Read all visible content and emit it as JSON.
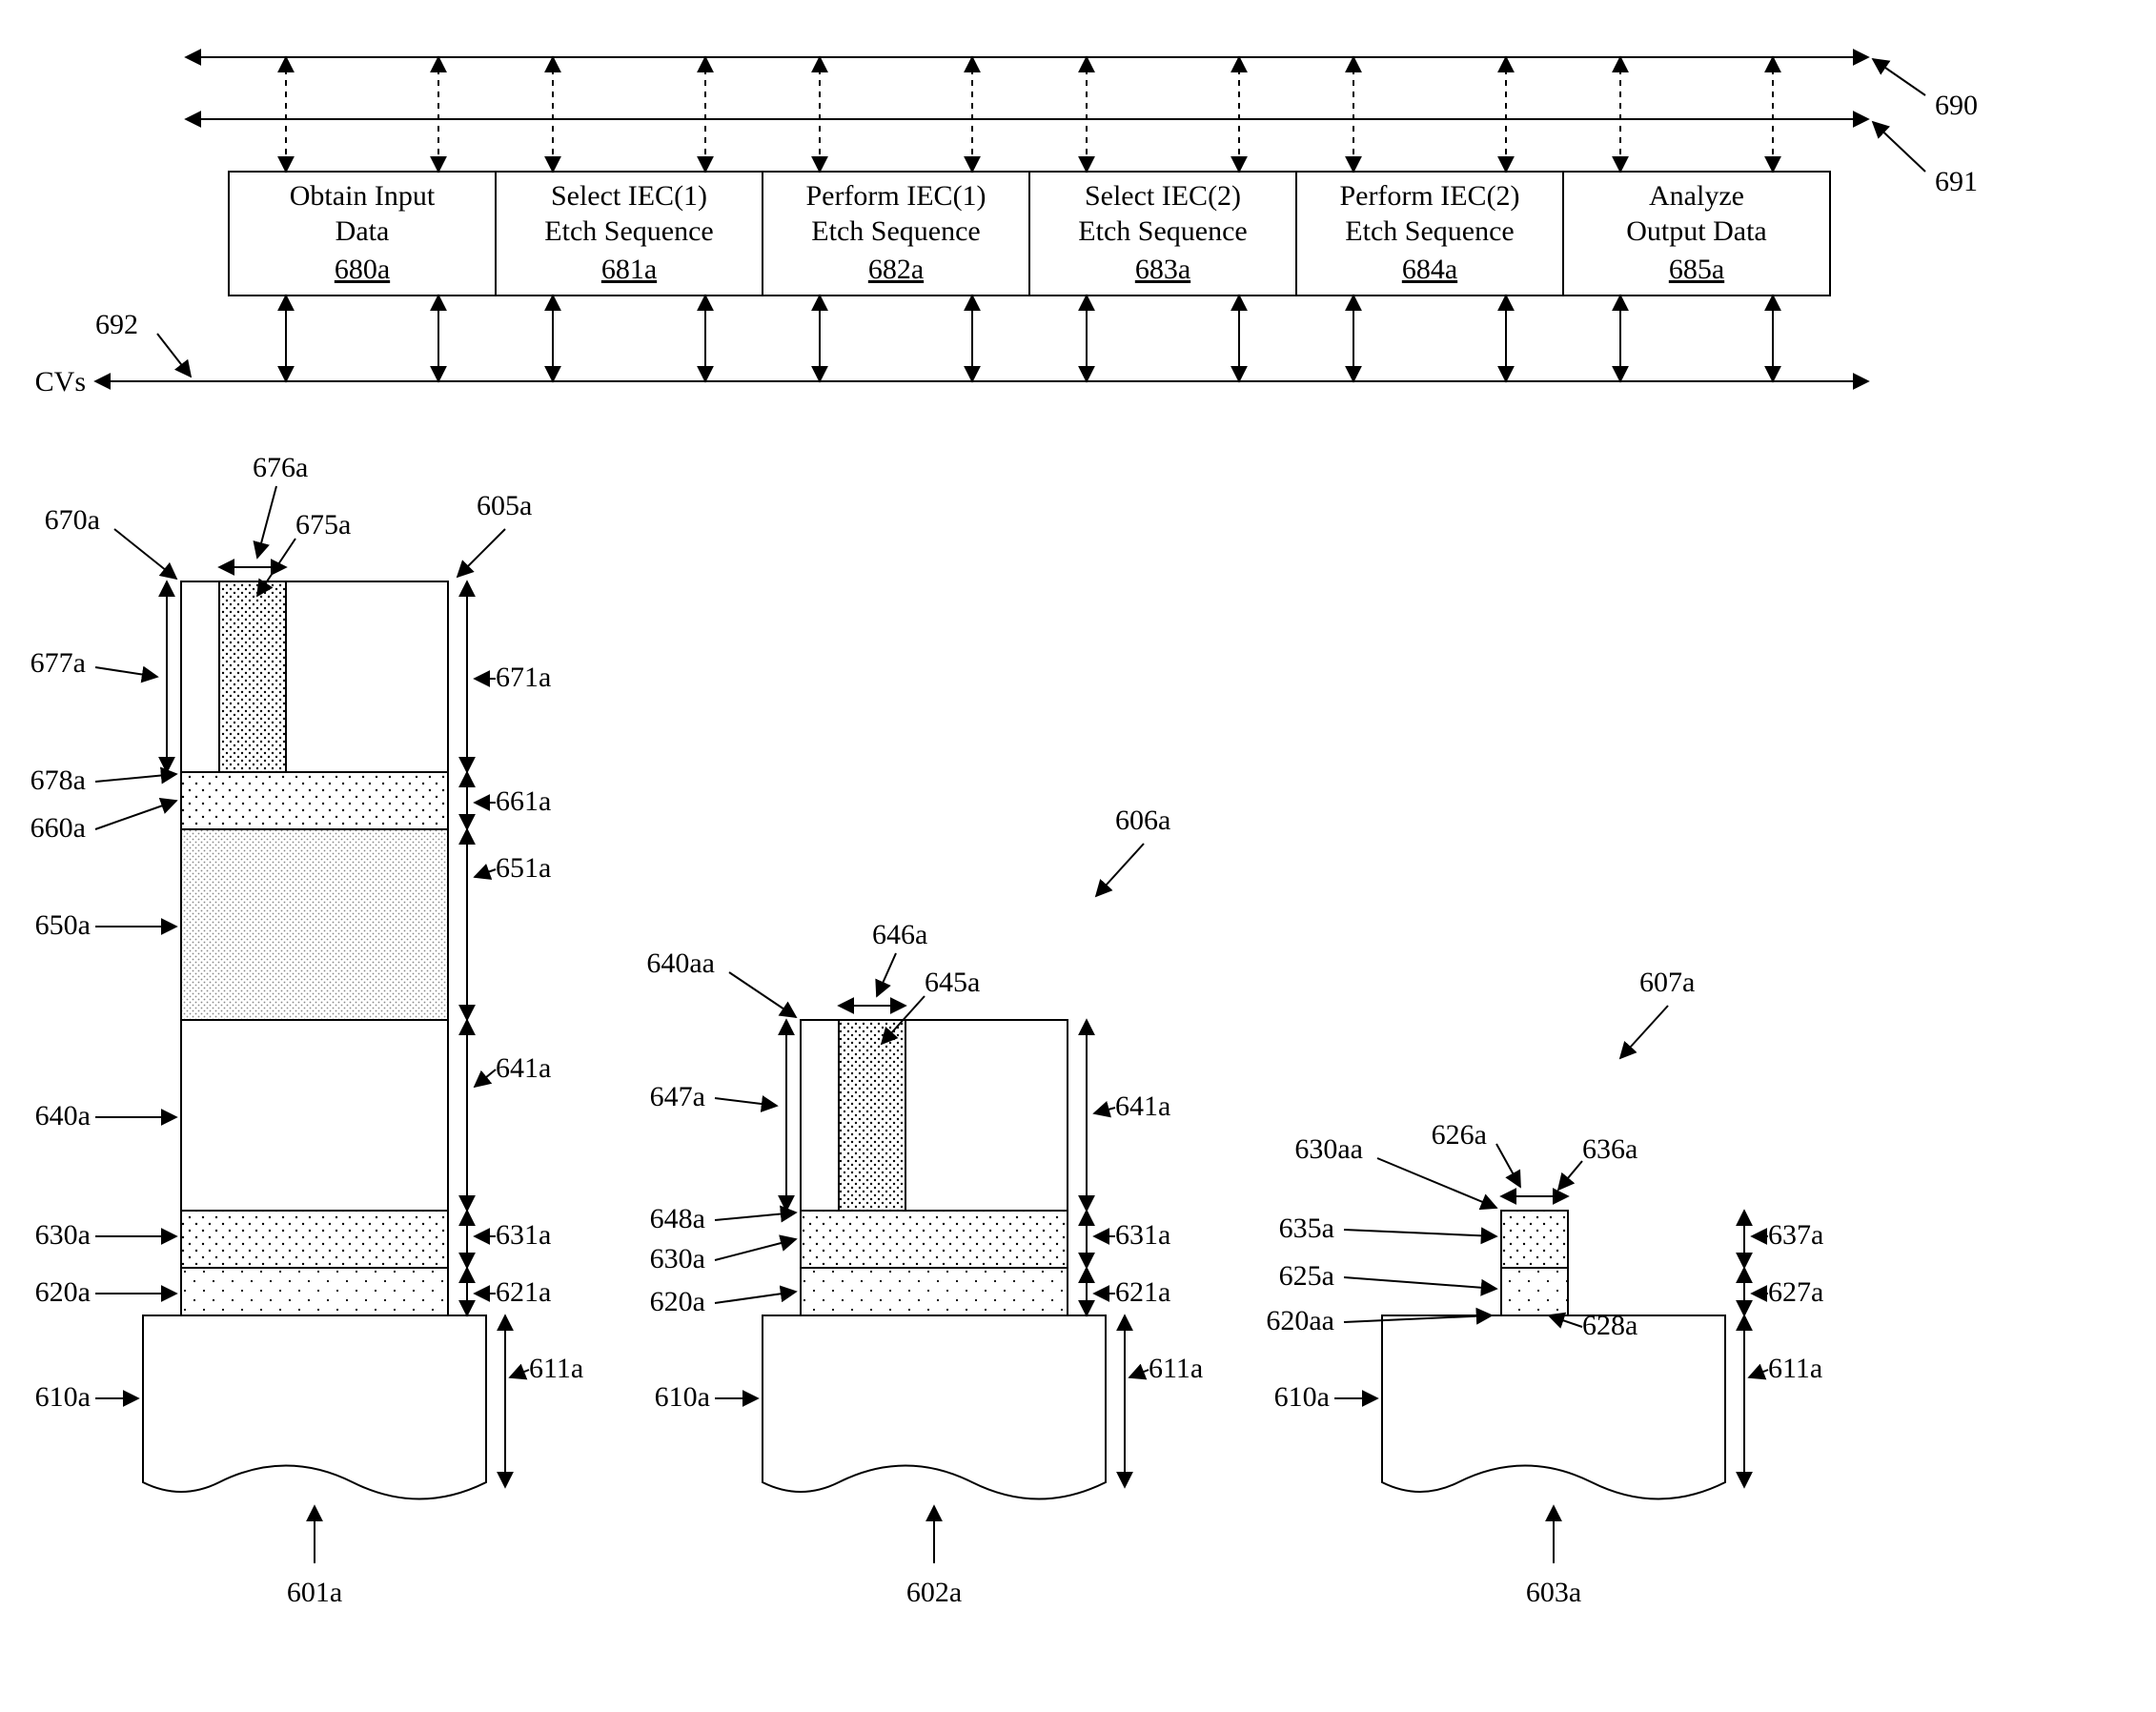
{
  "flow": {
    "steps": [
      {
        "line1": "Obtain Input",
        "line2": "Data",
        "ref": "680a"
      },
      {
        "line1": "Select IEC(1)",
        "line2": "Etch Sequence",
        "ref": "681a"
      },
      {
        "line1": "Perform IEC(1)",
        "line2": "Etch Sequence",
        "ref": "682a"
      },
      {
        "line1": "Select IEC(2)",
        "line2": "Etch Sequence",
        "ref": "683a"
      },
      {
        "line1": "Perform IEC(2)",
        "line2": "Etch Sequence",
        "ref": "684a"
      },
      {
        "line1": "Analyze",
        "line2": "Output Data",
        "ref": "685a"
      }
    ],
    "labels": {
      "top1": "690",
      "top2": "691",
      "left": "692",
      "cvs": "CVs"
    }
  },
  "stacks": {
    "s1": {
      "id": "605a",
      "bottom": "601a",
      "labels": {
        "l670a": "670a",
        "l676a": "676a",
        "l675a": "675a",
        "l677a": "677a",
        "l671a": "671a",
        "l678a": "678a",
        "l660a": "660a",
        "l661a": "661a",
        "l650a": "650a",
        "l651a": "651a",
        "l640a": "640a",
        "l641a": "641a",
        "l630a": "630a",
        "l631a": "631a",
        "l620a": "620a",
        "l621a": "621a",
        "l610a": "610a",
        "l611a": "611a"
      }
    },
    "s2": {
      "id": "606a",
      "bottom": "602a",
      "labels": {
        "l640aa": "640aa",
        "l646a": "646a",
        "l645a": "645a",
        "l647a": "647a",
        "l641a": "641a",
        "l648a": "648a",
        "l630a": "630a",
        "l631a": "631a",
        "l620a": "620a",
        "l621a": "621a",
        "l610a": "610a",
        "l611a": "611a"
      }
    },
    "s3": {
      "id": "607a",
      "bottom": "603a",
      "labels": {
        "l630aa": "630aa",
        "l626a": "626a",
        "l636a": "636a",
        "l635a": "635a",
        "l637a": "637a",
        "l625a": "625a",
        "l627a": "627a",
        "l620aa": "620aa",
        "l628a": "628a",
        "l610a": "610a",
        "l611a": "611a"
      }
    }
  }
}
